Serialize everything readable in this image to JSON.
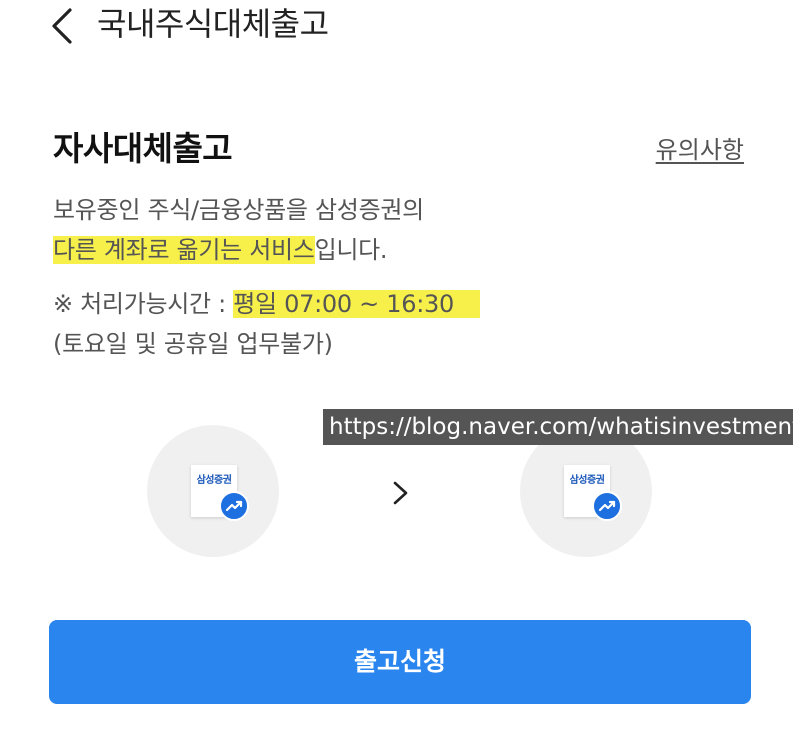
{
  "header": {
    "back_icon": "chevron-left-icon",
    "title": "국내주식대체출고"
  },
  "section": {
    "title": "자사대체출고",
    "notice_link": "유의사항"
  },
  "description": {
    "line1": "보유중인 주식/금융상품을 삼성증권의",
    "line2_highlight": "다른 계좌로 옮기는 서비스",
    "line2_rest": "입니다.",
    "line3_prefix": "※ 처리가능시간 : ",
    "line3_time": "평일 07:00 ~ 16:30",
    "line4": "(토요일 및 공휴일 업무불가)"
  },
  "transfer": {
    "from_brand": "삼성증권",
    "to_brand": "삼성증권",
    "arrow_icon": "chevron-right-icon",
    "badge_icon": "trend-up-icon"
  },
  "watermark": "https://blog.naver.com/whatisinvestment",
  "submit_label": "출고신청",
  "colors": {
    "primary": "#2a86ee",
    "highlight": "#f7f04a",
    "brand_blue": "#1a57b8",
    "badge": "#1e6fe0"
  }
}
